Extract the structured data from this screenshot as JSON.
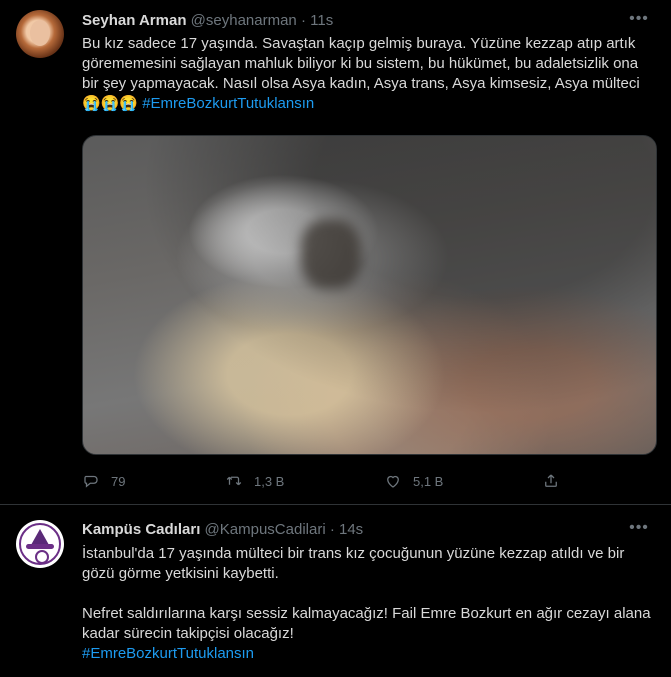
{
  "tweets": [
    {
      "name": "Seyhan Arman",
      "handle": "@seyhanarman",
      "dot": "·",
      "time": "11s",
      "more": "•••",
      "text": "Bu kız sadece 17 yaşında. Savaştan kaçıp gelmiş buraya. Yüzüne kezzap atıp artık görememesini sağlayan mahluk biliyor ki bu sistem, bu hükümet, bu adaletsizlik ona bir şey yapmayacak. Nasıl olsa Asya kadın, Asya trans, Asya kimsesiz, Asya mülteci ",
      "emoji": "😭😭😭",
      "hashtag": "#EmreBozkurtTutuklansın",
      "replies": "79",
      "retweets": "1,3 B",
      "likes": "5,1 B",
      "icons": {
        "reply": "reply-icon",
        "retweet": "retweet-icon",
        "like": "like-icon",
        "share": "share-icon"
      }
    },
    {
      "name": "Kampüs Cadıları",
      "handle": "@KampusCadilari",
      "dot": "·",
      "time": "14s",
      "more": "•••",
      "para1": "İstanbul'da 17 yaşında mülteci bir trans kız çocuğunun yüzüne kezzap atıldı ve bir gözü görme yetkisini kaybetti.",
      "para2": "Nefret saldırılarına karşı sessiz kalmayacağız! Fail Emre Bozkurt en ağır cezayı alana kadar sürecin takipçisi olacağız!",
      "hashtag": "#EmreBozkurtTutuklansın"
    }
  ],
  "colors": {
    "background": "#000000",
    "text": "#d9d9d9",
    "muted": "#6e767d",
    "link": "#1d9bf0",
    "divider": "#2f3336"
  }
}
